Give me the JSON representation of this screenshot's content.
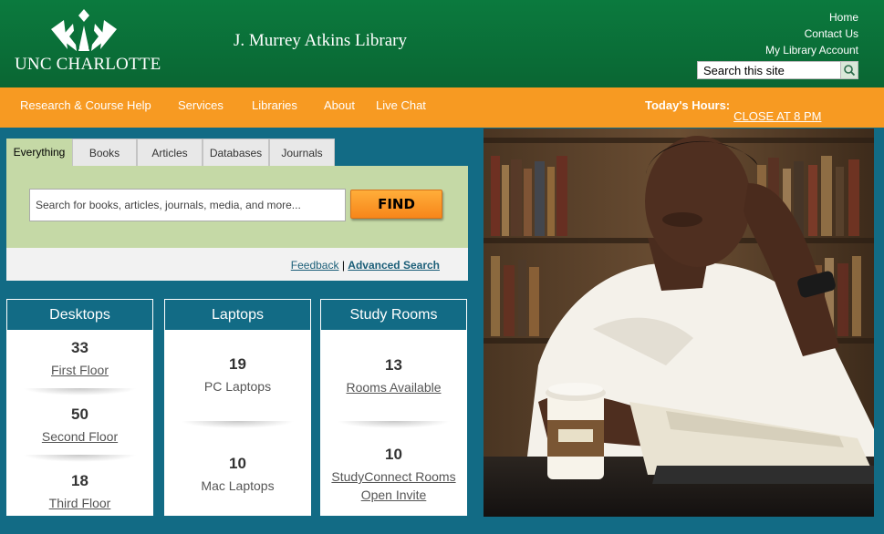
{
  "header": {
    "logo_text": "UNC CHARLOTTE",
    "site_title": "J. Murrey Atkins Library",
    "top_links": [
      "Home",
      "Contact Us",
      "My Library Account"
    ],
    "search_placeholder": "Search this site",
    "search_icon": "magnifier-icon"
  },
  "nav": {
    "items": [
      "Research & Course Help",
      "Services",
      "Libraries",
      "About",
      "Live Chat"
    ],
    "hours_label": "Today's Hours:",
    "hours_value": "CLOSE AT 8 PM"
  },
  "search": {
    "tabs": [
      "Everything",
      "Books",
      "Articles",
      "Databases",
      "Journals"
    ],
    "active_tab": "Everything",
    "placeholder": "Search for books, articles, journals, media, and more...",
    "find_label": "FIND",
    "feedback_label": "Feedback",
    "separator": "|",
    "advanced_label": "Advanced Search"
  },
  "cards": [
    {
      "title": "Desktops",
      "stats": [
        {
          "count": "33",
          "label": "First Floor"
        },
        {
          "count": "50",
          "label": "Second Floor"
        },
        {
          "count": "18",
          "label": "Third Floor"
        }
      ]
    },
    {
      "title": "Laptops",
      "stats": [
        {
          "count": "19",
          "label": "PC Laptops"
        },
        {
          "count": "10",
          "label": "Mac Laptops"
        }
      ]
    },
    {
      "title": "Study Rooms",
      "stats": [
        {
          "count": "13",
          "label": "Rooms Available"
        },
        {
          "count": "10",
          "label": "StudyConnect Rooms",
          "label2": "Open Invite"
        }
      ]
    }
  ],
  "colors": {
    "header_green": "#0b7a3e",
    "nav_orange": "#f79a22",
    "teal": "#126b85",
    "search_green": "#c5d9a6"
  }
}
